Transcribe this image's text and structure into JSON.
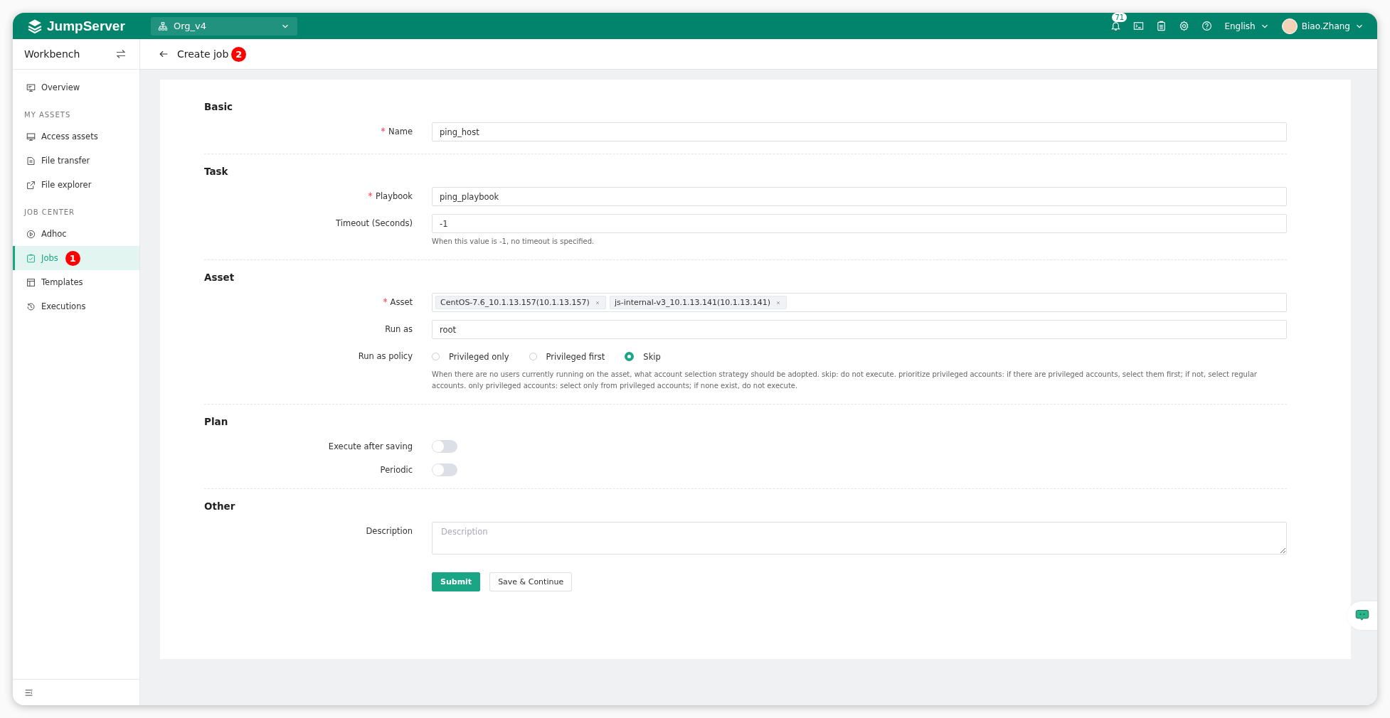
{
  "topbar": {
    "logo": "JumpServer",
    "org": "Org_v4",
    "notification_count": "71",
    "language": "English",
    "user": "Biao.Zhang"
  },
  "sidebar": {
    "title": "Workbench",
    "items": [
      {
        "kind": "item",
        "label": "Overview",
        "selected": false
      },
      {
        "kind": "group",
        "label": "MY ASSETS"
      },
      {
        "kind": "item",
        "label": "Access assets",
        "selected": false
      },
      {
        "kind": "item",
        "label": "File transfer",
        "selected": false
      },
      {
        "kind": "item",
        "label": "File explorer",
        "selected": false
      },
      {
        "kind": "group",
        "label": "JOB CENTER"
      },
      {
        "kind": "item",
        "label": "Adhoc",
        "selected": false
      },
      {
        "kind": "item",
        "label": "Jobs",
        "selected": true,
        "badge": "1"
      },
      {
        "kind": "item",
        "label": "Templates",
        "selected": false
      },
      {
        "kind": "item",
        "label": "Executions",
        "selected": false
      }
    ]
  },
  "header": {
    "title": "Create job",
    "badge": "2"
  },
  "form": {
    "sections": [
      {
        "title": "Basic",
        "fields": [
          {
            "kind": "text",
            "label": "Name",
            "required": true,
            "value": "ping_host"
          }
        ]
      },
      {
        "title": "Task",
        "fields": [
          {
            "kind": "text",
            "label": "Playbook",
            "required": true,
            "value": "ping_playbook"
          },
          {
            "kind": "text",
            "label": "Timeout (Seconds)",
            "required": false,
            "value": "-1",
            "help": "When this value is -1, no timeout is specified."
          }
        ]
      },
      {
        "title": "Asset",
        "fields": [
          {
            "kind": "tags",
            "label": "Asset",
            "required": true,
            "tags": [
              "CentOS-7.6_10.1.13.157(10.1.13.157)",
              "js-internal-v3_10.1.13.141(10.1.13.141)"
            ]
          },
          {
            "kind": "text",
            "label": "Run as",
            "required": false,
            "value": "root"
          },
          {
            "kind": "radio",
            "label": "Run as policy",
            "required": false,
            "options": [
              {
                "label": "Privileged only",
                "selected": false
              },
              {
                "label": "Privileged first",
                "selected": false
              },
              {
                "label": "Skip",
                "selected": true
              }
            ],
            "help": "When there are no users currently running on the asset, what account selection strategy should be adopted. skip: do not execute. prioritize privileged accounts: if there are privileged accounts, select them first; if not, select regular accounts. only privileged accounts: select only from privileged accounts; if none exist, do not execute."
          }
        ]
      },
      {
        "title": "Plan",
        "fields": [
          {
            "kind": "toggle",
            "label": "Execute after saving",
            "required": false,
            "on": false
          },
          {
            "kind": "toggle",
            "label": "Periodic",
            "required": false,
            "on": false
          }
        ]
      },
      {
        "title": "Other",
        "fields": [
          {
            "kind": "textarea",
            "label": "Description",
            "required": false,
            "placeholder": "Description"
          }
        ]
      }
    ]
  },
  "buttons": [
    {
      "label": "Submit",
      "primary": true
    },
    {
      "label": "Save & Continue",
      "primary": false
    }
  ]
}
